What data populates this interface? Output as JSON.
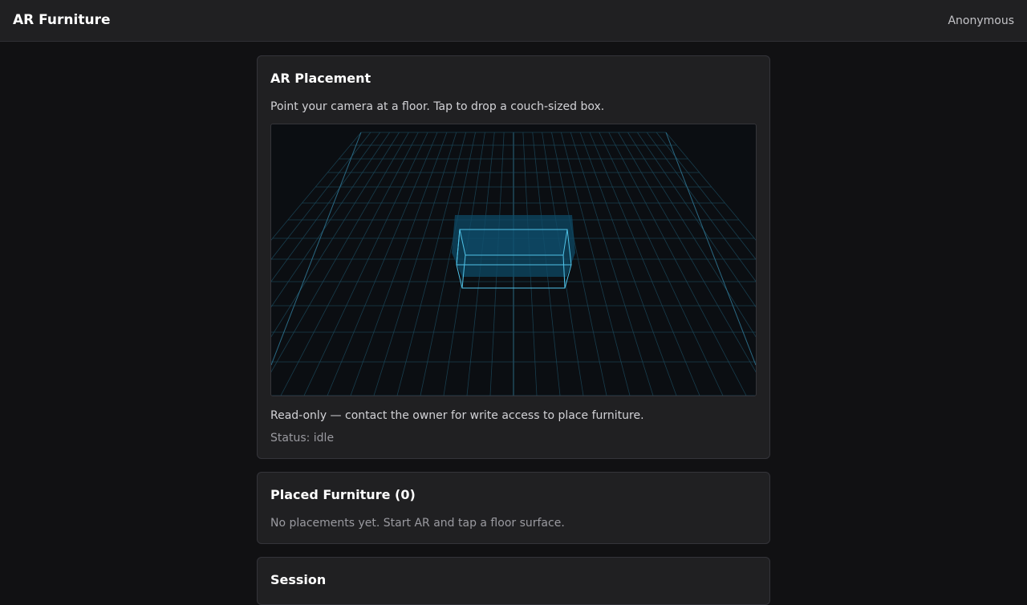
{
  "header": {
    "app_title": "AR Furniture",
    "user": "Anonymous"
  },
  "ar_card": {
    "title": "AR Placement",
    "instruction": "Point your camera at a floor. Tap to drop a couch-sized box.",
    "readonly_note": "Read-only — contact the owner for write access to place furniture.",
    "status": "Status: idle"
  },
  "placed_card": {
    "title": "Placed Furniture (0)",
    "empty_text": "No placements yet. Start AR and tap a floor surface."
  },
  "session_card": {
    "title": "Session"
  },
  "colors": {
    "grid": "#1c4a5c",
    "grid_center": "#2a6a84",
    "box_fill": "#0e4a66",
    "box_edge": "#4fc3e8"
  }
}
